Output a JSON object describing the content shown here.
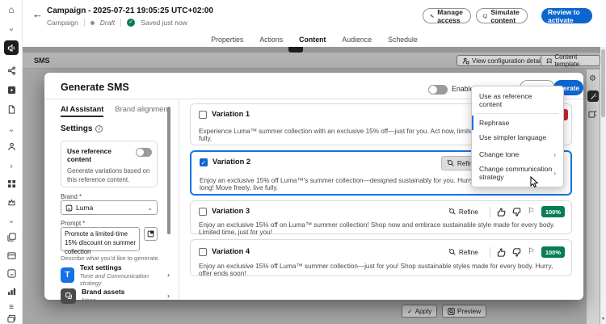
{
  "icons": {
    "back": "←",
    "chevron_down": "⌄",
    "chevron_right": "›",
    "check": "✓",
    "gear": "⚙",
    "flag": "⚐",
    "hamburger": "≡",
    "home": "⌂",
    "scroll_down": "▾",
    "info": "i"
  },
  "colors": {
    "accent": "#0d66d0",
    "selection": "#1473e6",
    "positive": "#077d55",
    "negative": "#c9252d"
  },
  "header": {
    "title": "Campaign - 2025-07-21 19:05:25 UTC+02:00",
    "breadcrumb": "Campaign",
    "status": "Draft",
    "saved": "Saved just now",
    "manage_access": "Manage access",
    "simulate_content": "Simulate content",
    "review_to_activate": "Review to activate"
  },
  "tabs": {
    "items": [
      "Properties",
      "Actions",
      "Content",
      "Audience",
      "Schedule"
    ],
    "selected": "Content"
  },
  "sms": {
    "label": "SMS",
    "view_config": "View configuration details",
    "content_template": "Content template"
  },
  "dialog": {
    "title": "Generate SMS",
    "enable_label": "Enable e",
    "generate_label": "Generate",
    "panel": {
      "tab_ai": "AI Assistant",
      "tab_brand": "Brand alignment",
      "settings": "Settings",
      "ref_title": "Use reference content",
      "ref_desc": "Generate variations based on this reference content.",
      "brand_label": "Brand *",
      "brand_value": "Luma",
      "prompt_label": "Prompt *",
      "prompt_value": "Promote a limited-time 15% discount on summer collection",
      "prompt_help": "Describe what you'd like to generate.",
      "text_settings": "Text settings",
      "text_settings_sub": "Tone and Communication strategy",
      "text_settings_glyph": "T",
      "brand_assets": "Brand assets",
      "brand_assets_sub": "None"
    },
    "refine": "Refine",
    "variations": [
      {
        "title": "Variation 1",
        "text": "Experience Luma™ summer collection with an exclusive 15% off—just for you. Act now, limited time only! Move freely, live fully.",
        "score": ""
      },
      {
        "title": "Variation 2",
        "text": "Enjoy an exclusive 15% off Luma™'s summer collection—designed sustainably for you. Hurry, this special offer won't last long! Move freely, live fully.",
        "score": "100%"
      },
      {
        "title": "Variation 3",
        "text": "Enjoy an exclusive 15% off on Luma™ summer collection! Shop now and embrace sustainable style made for every body. Limited time, just for you!",
        "score": "100%"
      },
      {
        "title": "Variation 4",
        "text": "Enjoy an exclusive 15% off Luma™ summer collection—just for you! Shop sustainable styles made for every body. Hurry, offer ends soon!",
        "score": "100%"
      }
    ],
    "menu": {
      "items": [
        "Use as reference content",
        "Rephrase",
        "Use simpler language",
        "Change tone",
        "Change communication strategy"
      ]
    }
  },
  "footer": {
    "apply": "Apply",
    "preview": "Preview"
  }
}
